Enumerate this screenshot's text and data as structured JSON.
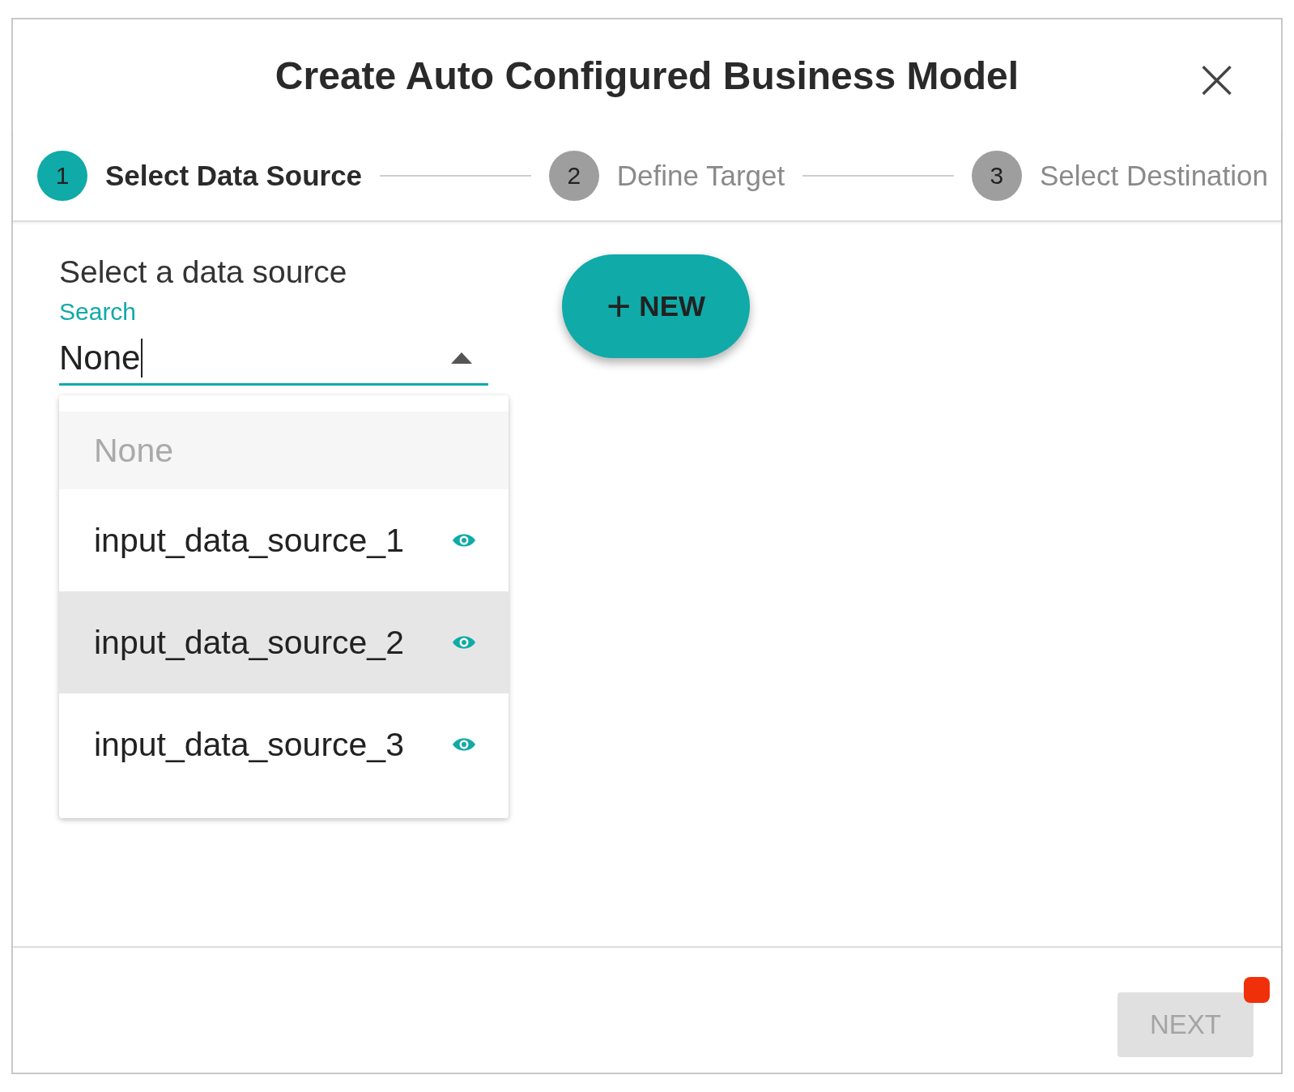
{
  "dialog": {
    "title": "Create Auto Configured Business Model",
    "close": "×"
  },
  "steps": [
    {
      "number": "1",
      "label": "Select Data Source",
      "selected": true
    },
    {
      "number": "2",
      "label": "Define Target",
      "selected": false
    },
    {
      "number": "3",
      "label": "Select Destination",
      "selected": false
    }
  ],
  "source": {
    "label": "Select a data source",
    "field_label": "Search",
    "value": "None",
    "expanded": true
  },
  "options": [
    {
      "label": "None",
      "kind": "empty",
      "selected": true,
      "hovered": false
    },
    {
      "label": "input_data_source_1",
      "kind": "source",
      "selected": false,
      "hovered": false
    },
    {
      "label": "input_data_source_2",
      "kind": "source",
      "selected": false,
      "hovered": true
    },
    {
      "label": "input_data_source_3",
      "kind": "source",
      "selected": false,
      "hovered": false
    }
  ],
  "new_button": {
    "icon": "+",
    "label": "NEW"
  },
  "next_button": {
    "label": "NEXT",
    "disabled": true
  }
}
